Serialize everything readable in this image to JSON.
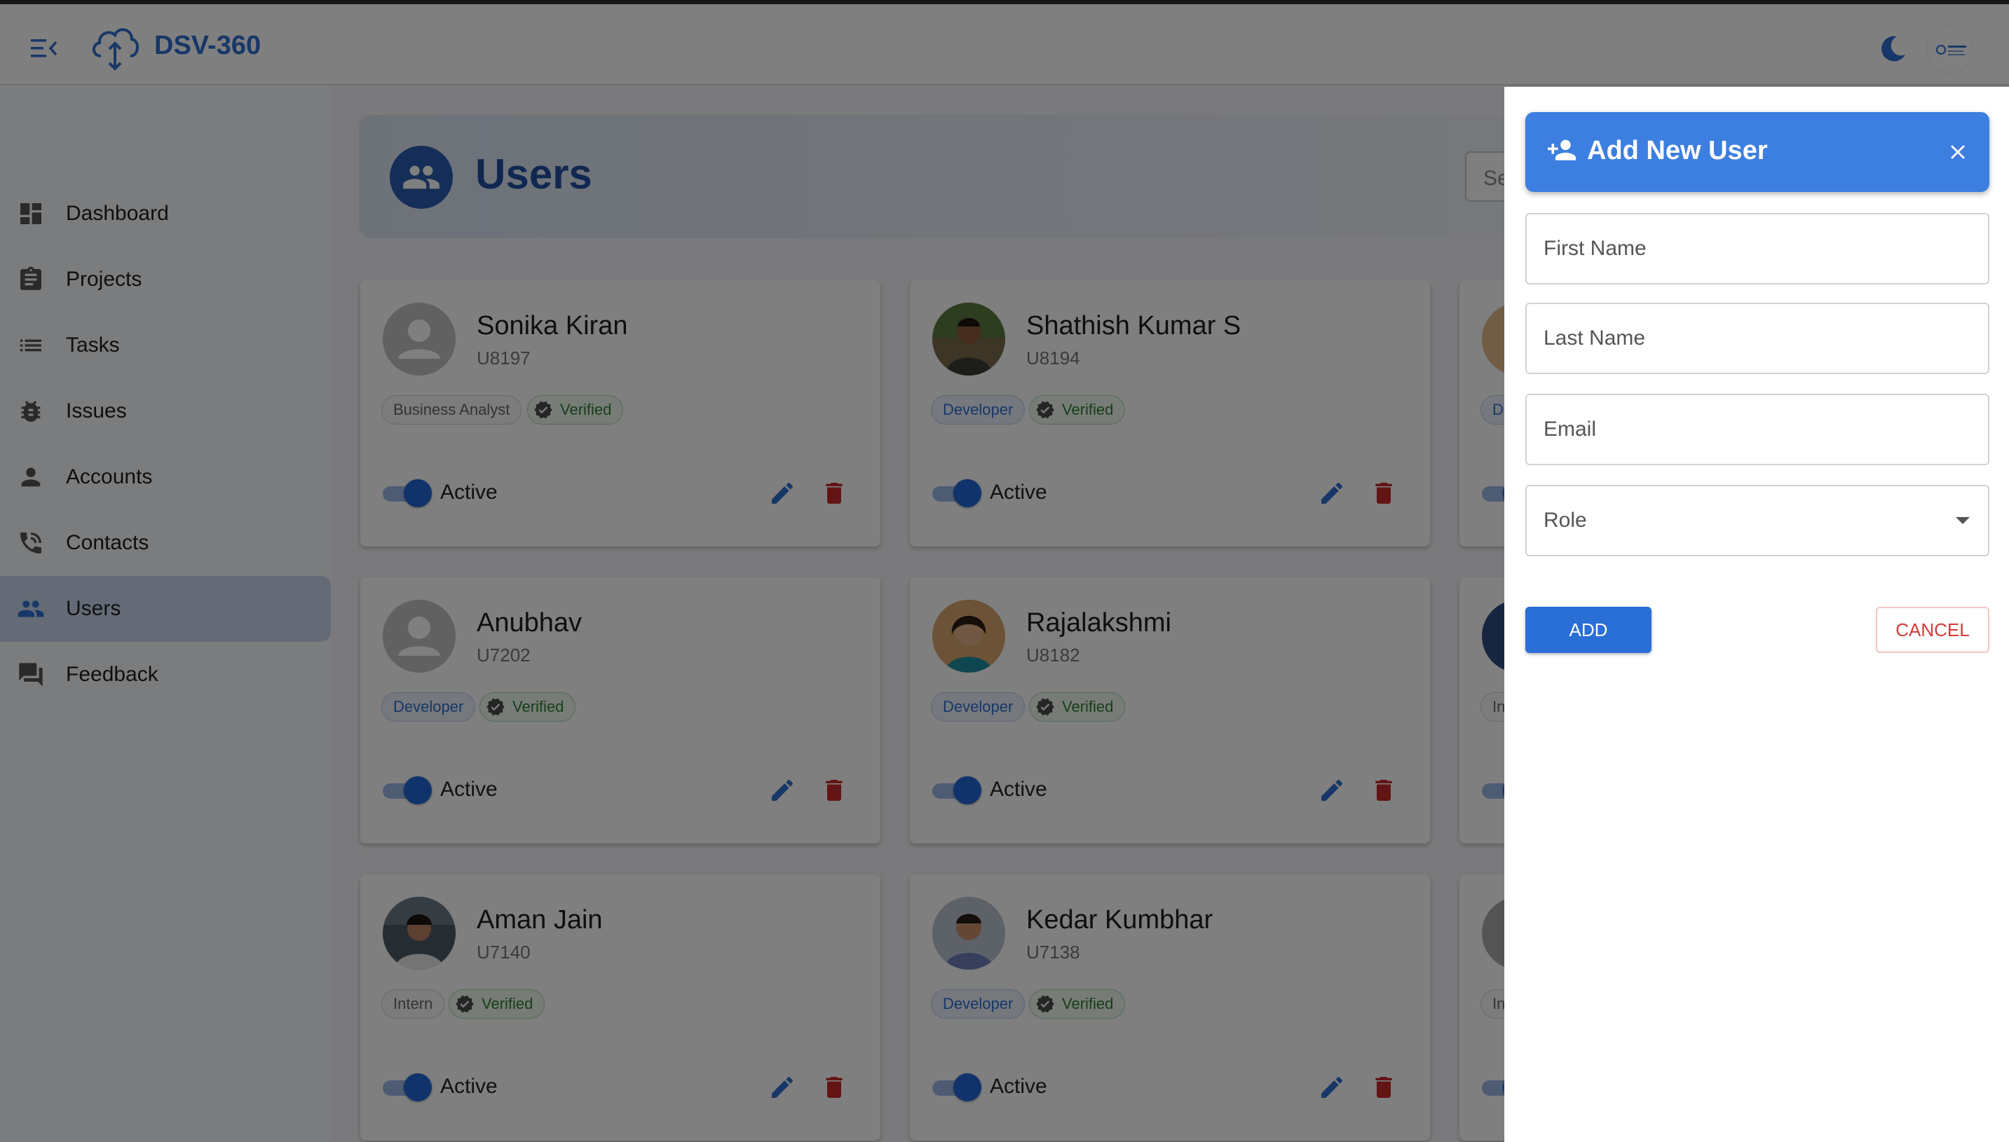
{
  "app": {
    "brand": "DSV-360",
    "menu_icon": "menu-collapse-icon",
    "logo_icon": "cloud-upload-icon",
    "theme_icon": "moon-icon",
    "avatar_icon": "company-logo-avatar"
  },
  "sidebar": {
    "items": [
      {
        "label": "Dashboard",
        "icon": "dashboard-icon",
        "active": false
      },
      {
        "label": "Projects",
        "icon": "clipboard-icon",
        "active": false
      },
      {
        "label": "Tasks",
        "icon": "list-icon",
        "active": false
      },
      {
        "label": "Issues",
        "icon": "bug-icon",
        "active": false
      },
      {
        "label": "Accounts",
        "icon": "person-icon",
        "active": false
      },
      {
        "label": "Contacts",
        "icon": "phone-in-talk-icon",
        "active": false
      },
      {
        "label": "Users",
        "icon": "people-icon",
        "active": true
      },
      {
        "label": "Feedback",
        "icon": "chat-bubbles-icon",
        "active": false
      }
    ]
  },
  "main": {
    "title": "Users",
    "search_placeholder": "Se"
  },
  "users": [
    {
      "name": "Sonika Kiran",
      "id": "U8197",
      "role": "Business Analyst",
      "verified": "Verified",
      "status": "Active",
      "photo": false
    },
    {
      "name": "Shathish Kumar S",
      "id": "U8194",
      "role": "Developer",
      "verified": "Verified",
      "status": "Active",
      "photo": true
    },
    {
      "name": "Anubhav",
      "id": "U7202",
      "role": "Developer",
      "verified": "Verified",
      "status": "Active",
      "photo": false
    },
    {
      "name": "Rajalakshmi",
      "id": "U8182",
      "role": "Developer",
      "verified": "Verified",
      "status": "Active",
      "photo": true
    },
    {
      "name": "Aman Jain",
      "id": "U7140",
      "role": "Intern",
      "verified": "Verified",
      "status": "Active",
      "photo": true
    },
    {
      "name": "Kedar Kumbhar",
      "id": "U7138",
      "role": "Developer",
      "verified": "Verified",
      "status": "Active",
      "photo": true
    }
  ],
  "partial_cards": [
    {
      "role_fragment": "De"
    },
    {
      "role_fragment": "In"
    },
    {
      "role_fragment": "In"
    }
  ],
  "drawer": {
    "title": "Add New User",
    "first_name_placeholder": "First Name",
    "last_name_placeholder": "Last Name",
    "email_placeholder": "Email",
    "role_placeholder": "Role",
    "add_label": "ADD",
    "cancel_label": "CANCEL"
  },
  "colors": {
    "accent": "#2f6fd1",
    "delete": "#c62828",
    "verified": "#2e7d32"
  }
}
